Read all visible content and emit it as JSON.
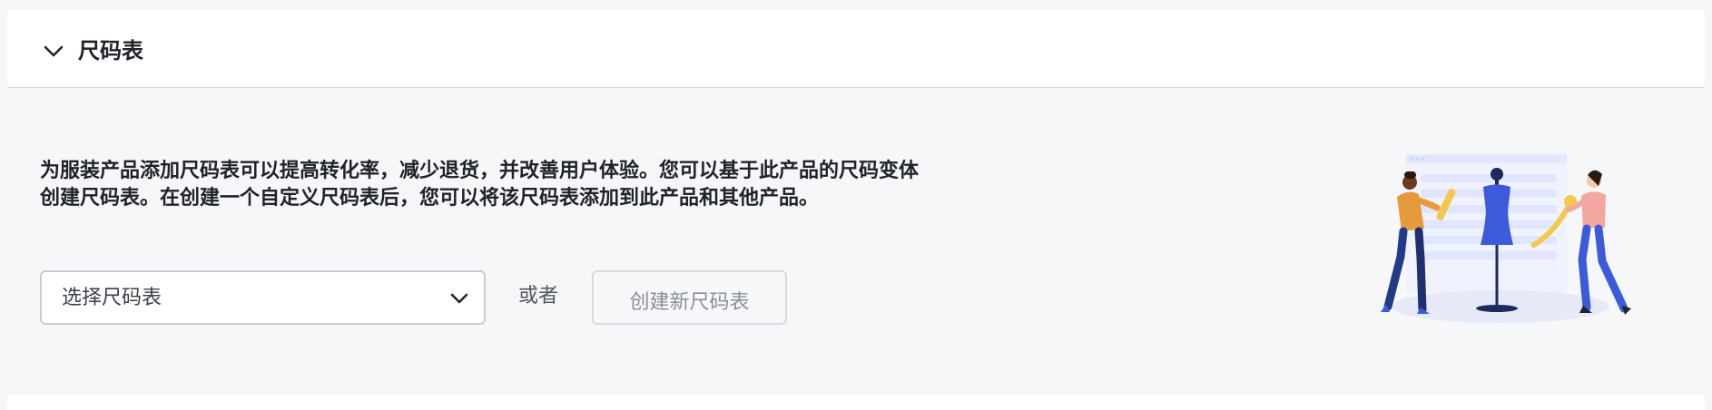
{
  "header": {
    "title": "尺码表",
    "toggle_icon": "chevron-down-icon"
  },
  "body": {
    "description": "为服装产品添加尺码表可以提高转化率，减少退货，并改善用户体验。您可以基于此产品的尺码变体创建尺码表。在创建一个自定义尺码表后，您可以将该尺码表添加到此产品和其他产品。",
    "select": {
      "placeholder": "选择尺码表",
      "icon": "chevron-down-icon"
    },
    "or_text": "或者",
    "create_button": {
      "label": "创建新尺码表",
      "disabled": true
    },
    "illustration": "size-chart-measuring-illustration"
  },
  "colors": {
    "accent_blue": "#3b5bdb",
    "illustration_yellow": "#f2c94c",
    "illustration_orange": "#e59a3c",
    "illustration_pink": "#f4a6a0"
  }
}
